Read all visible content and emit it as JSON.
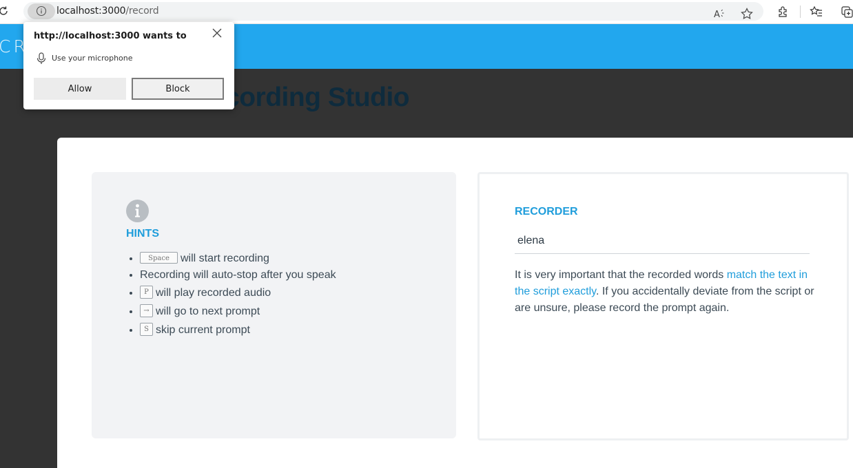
{
  "browser": {
    "url_host": "localhost:3000",
    "url_path": "/record",
    "icons": [
      "reload-icon",
      "site-info-icon",
      "read-aloud-icon",
      "favorite-star-icon",
      "extensions-icon",
      "favorites-icon",
      "collections-icon"
    ]
  },
  "permission_popup": {
    "title": "http://localhost:3000 wants to",
    "permission": "Use your microphone",
    "allow_label": "Allow",
    "block_label": "Block"
  },
  "appbar": {
    "logo_text": "CRO"
  },
  "page": {
    "title_visible": "cording Studio"
  },
  "hints": {
    "title": "HINTS",
    "items": [
      {
        "key": "Space",
        "text": "will start recording"
      },
      {
        "key": "",
        "text": "Recording will auto-stop after you speak"
      },
      {
        "key": "P",
        "text": "will play recorded audio"
      },
      {
        "key": "→",
        "text": "will go to next prompt"
      },
      {
        "key": "S",
        "text": "skip current prompt"
      }
    ]
  },
  "recorder": {
    "title": "RECORDER",
    "name_value": "elena",
    "text_before": "It is very important that the recorded words ",
    "text_highlight": "match the text in the script exactly",
    "text_after": ". If you accidentally deviate from the script or are unsure, please record the prompt again."
  },
  "colors": {
    "accent": "#22a7ee",
    "link": "#1f9ddb",
    "background": "#333333",
    "title": "#0e2b3d"
  }
}
